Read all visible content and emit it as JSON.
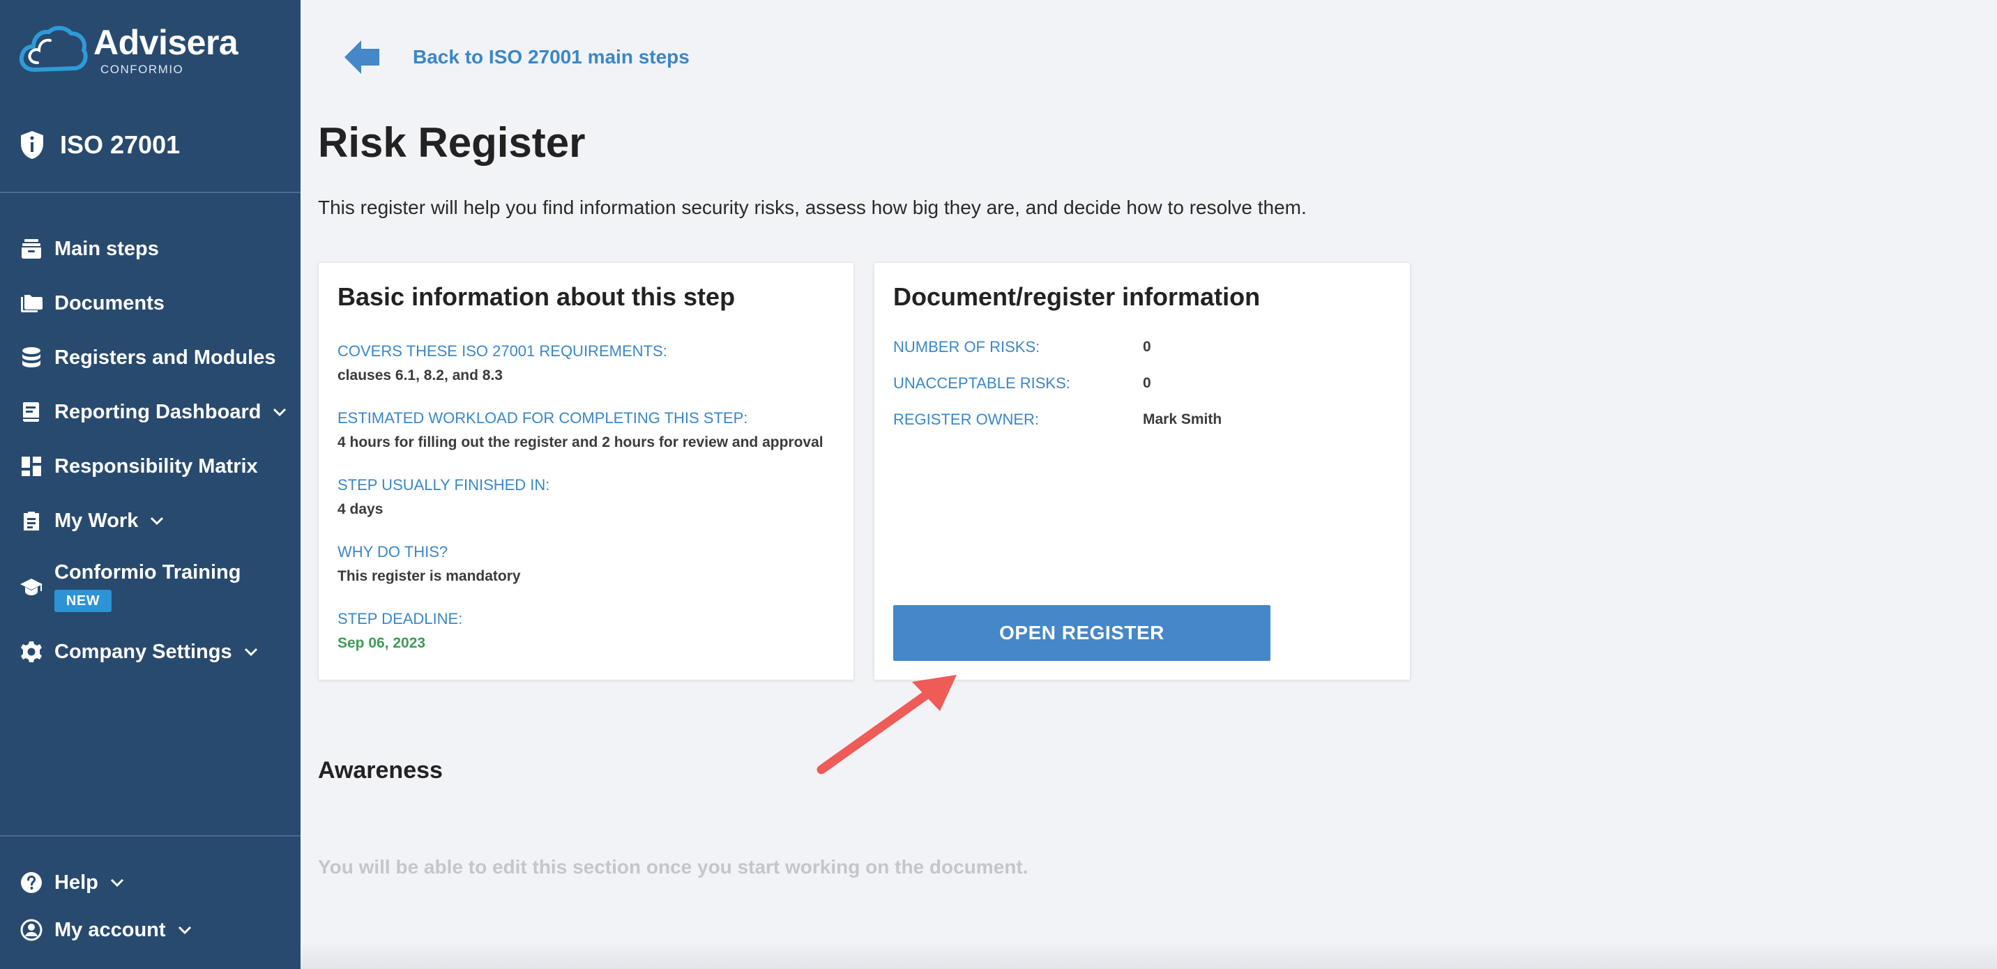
{
  "app": {
    "brand": "Advisera",
    "brand_sub": "CONFORMIO",
    "product": "ISO 27001"
  },
  "sidebar": {
    "items": [
      {
        "label": "Main steps",
        "icon": "layers-icon"
      },
      {
        "label": "Documents",
        "icon": "folders-icon"
      },
      {
        "label": "Registers and Modules",
        "icon": "database-icon"
      },
      {
        "label": "Reporting Dashboard",
        "icon": "report-icon",
        "expandable": true
      },
      {
        "label": "Responsibility Matrix",
        "icon": "grid-icon"
      },
      {
        "label": "My Work",
        "icon": "clipboard-icon",
        "expandable": true
      },
      {
        "label": "Conformio Training",
        "icon": "graduation-cap-icon",
        "badge": "NEW"
      },
      {
        "label": "Company Settings",
        "icon": "gear-icon",
        "expandable": true
      }
    ],
    "bottom": [
      {
        "label": "Help",
        "icon": "help-icon",
        "expandable": true
      },
      {
        "label": "My account",
        "icon": "user-icon",
        "expandable": true
      }
    ]
  },
  "main": {
    "back_label": "Back to ISO 27001 main steps",
    "title": "Risk Register",
    "description": "This register will help you find information security risks, assess how big they are, and decide how to resolve them.",
    "info_card": {
      "title": "Basic information about this step",
      "fields": [
        {
          "label": "COVERS THESE ISO 27001 REQUIREMENTS:",
          "value": "clauses 6.1, 8.2, and 8.3"
        },
        {
          "label": "ESTIMATED WORKLOAD FOR COMPLETING THIS STEP:",
          "value": "4 hours for filling out the register and 2 hours for review and approval"
        },
        {
          "label": "STEP USUALLY FINISHED IN:",
          "value": "4 days"
        },
        {
          "label": "WHY DO THIS?",
          "value": "This register is mandatory"
        },
        {
          "label": "STEP DEADLINE:",
          "value": "Sep 06, 2023"
        }
      ]
    },
    "doc_card": {
      "title": "Document/register information",
      "rows": [
        {
          "label": "NUMBER OF RISKS:",
          "value": "0"
        },
        {
          "label": "UNACCEPTABLE RISKS:",
          "value": "0"
        },
        {
          "label": "REGISTER OWNER:",
          "value": "Mark Smith"
        }
      ],
      "button_label": "OPEN REGISTER"
    },
    "awareness": {
      "title": "Awareness",
      "note": "You will be able to edit this section once you start working on the document."
    }
  },
  "colors": {
    "sidebar_bg": "#284a6f",
    "accent_blue": "#3a87c9",
    "button_blue": "#4587c8",
    "deadline_green": "#3f9a57",
    "badge_blue": "#2c93d6",
    "annotation_arrow": "#ef5b57"
  }
}
